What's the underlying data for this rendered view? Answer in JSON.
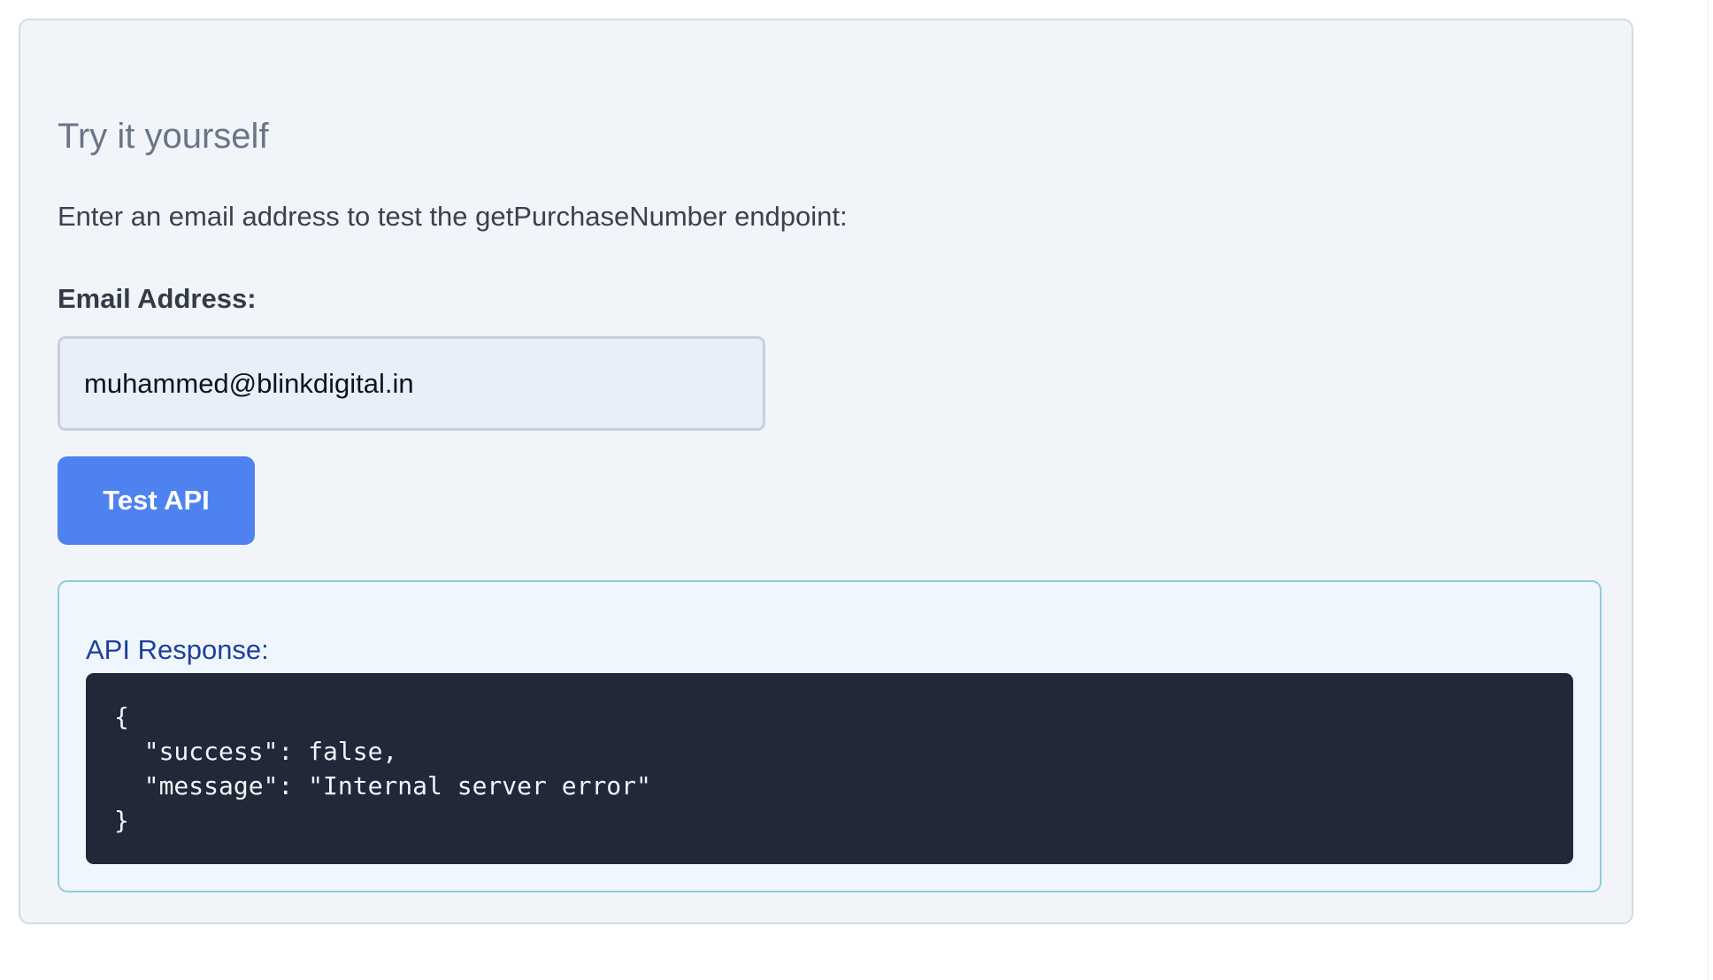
{
  "try_it": {
    "heading": "Try it yourself",
    "description": "Enter an email address to test the getPurchaseNumber endpoint:",
    "email_label": "Email Address:",
    "email_value": "muhammed@blinkdigital.in",
    "button_label": "Test API"
  },
  "response": {
    "title": "API Response:",
    "body": "{\n  \"success\": false,\n  \"message\": \"Internal server error\"\n}"
  },
  "colors": {
    "accent": "#4d82f0",
    "card_background": "#f1f4f9",
    "response_border": "#8ecce0",
    "response_title": "#1f3f9c",
    "code_background": "#212838"
  }
}
